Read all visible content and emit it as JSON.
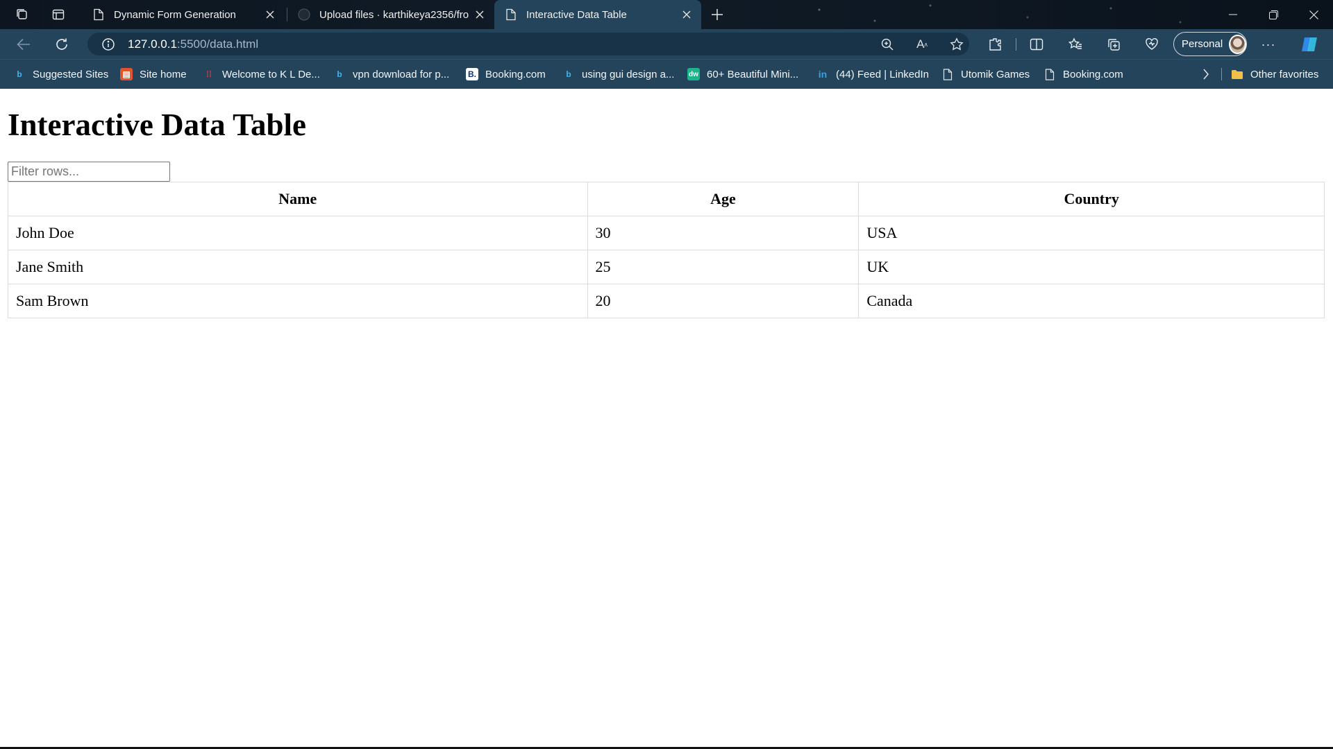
{
  "browser": {
    "tabs": [
      {
        "label": "Dynamic Form Generation",
        "active": false,
        "favicon": "page-icon"
      },
      {
        "label": "Upload files · karthikeya2356/fro",
        "active": false,
        "favicon": "github-icon"
      },
      {
        "label": "Interactive Data Table",
        "active": true,
        "favicon": "page-icon"
      }
    ],
    "address": {
      "host": "127.0.0.1",
      "rest": ":5500/data.html"
    },
    "profile_label": "Personal",
    "favorites": [
      {
        "label": "Suggested Sites",
        "icon": "bing-icon"
      },
      {
        "label": "Site home",
        "icon": "site-home-icon"
      },
      {
        "label": "Welcome to K L De...",
        "icon": "kl-icon"
      },
      {
        "label": "vpn download for p...",
        "icon": "bing-icon"
      },
      {
        "label": "Booking.com",
        "icon": "booking-icon"
      },
      {
        "label": "using gui design a...",
        "icon": "bing-icon"
      },
      {
        "label": "60+ Beautiful Mini...",
        "icon": "dw-icon"
      },
      {
        "label": "(44) Feed | LinkedIn",
        "icon": "linkedin-icon"
      },
      {
        "label": "Utomik Games",
        "icon": "page-icon"
      },
      {
        "label": "Booking.com",
        "icon": "page-icon"
      }
    ],
    "other_favorites": "Other favorites"
  },
  "page": {
    "title": "Interactive Data Table",
    "filter_placeholder": "Filter rows...",
    "table": {
      "headers": [
        "Name",
        "Age",
        "Country"
      ],
      "rows": [
        [
          "John Doe",
          "30",
          "USA"
        ],
        [
          "Jane Smith",
          "25",
          "UK"
        ],
        [
          "Sam Brown",
          "20",
          "Canada"
        ]
      ]
    }
  },
  "colors": {
    "toolbar": "#24445c",
    "active_tab": "#24445c",
    "titlebar": "#0d1620"
  }
}
